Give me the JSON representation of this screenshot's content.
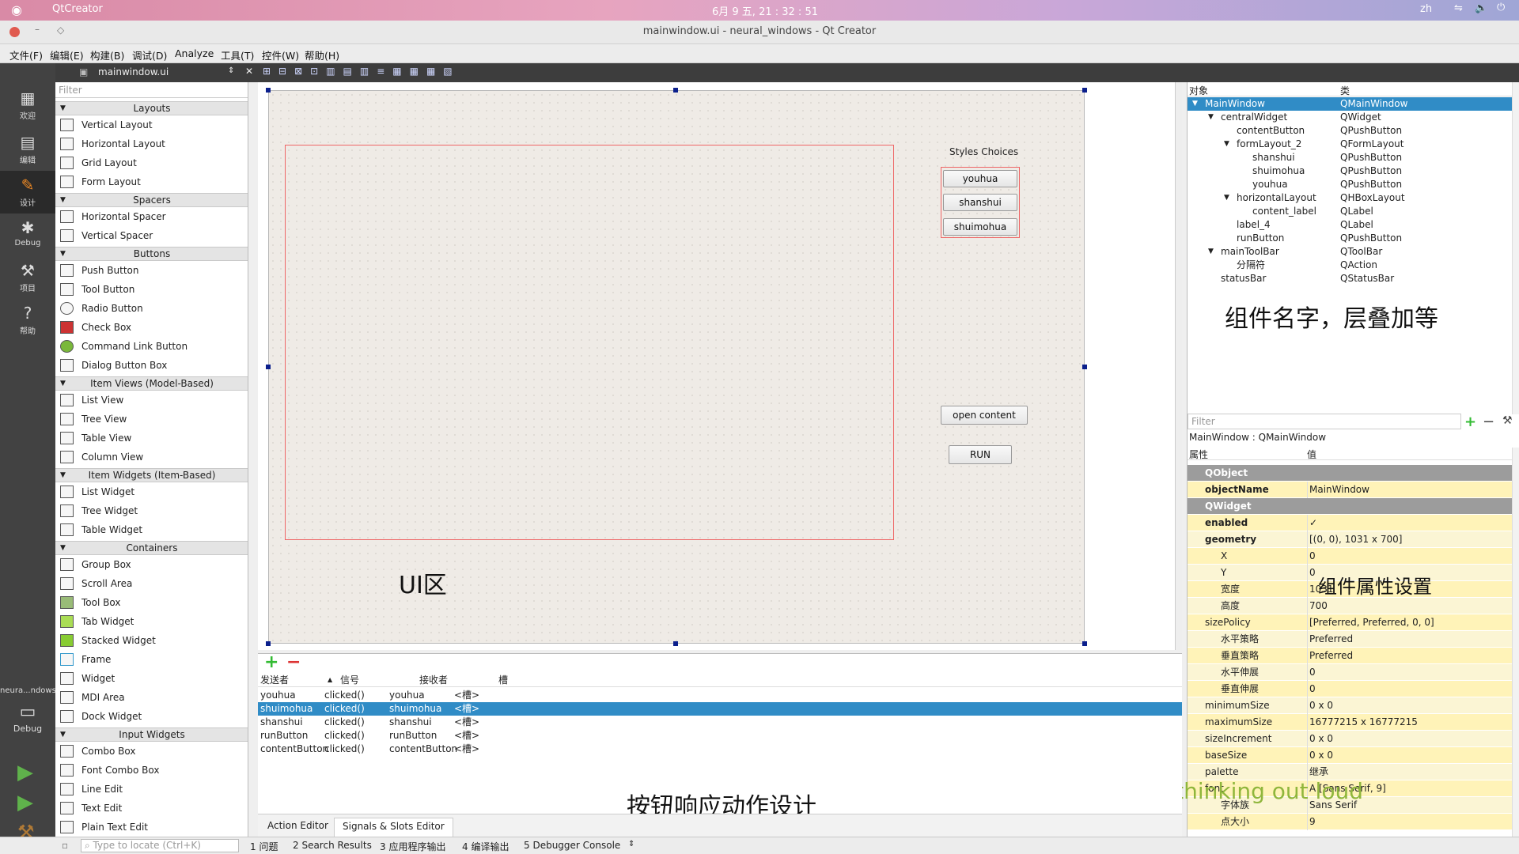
{
  "system_bar": {
    "app_name": "QtCreator",
    "datetime": "6月 9 五, 21 : 32 : 51",
    "lang": "zh"
  },
  "window": {
    "title": "mainwindow.ui - neural_windows - Qt Creator"
  },
  "menu": [
    "文件(F)",
    "编辑(E)",
    "构建(B)",
    "调试(D)",
    "Analyze",
    "工具(T)",
    "控件(W)",
    "帮助(H)"
  ],
  "modes": [
    {
      "label": "欢迎",
      "icon": "grid-icon"
    },
    {
      "label": "编辑",
      "icon": "edit-icon"
    },
    {
      "label": "设计",
      "icon": "design-icon"
    },
    {
      "label": "Debug",
      "icon": "bug-icon"
    },
    {
      "label": "项目",
      "icon": "wrench-icon"
    },
    {
      "label": "帮助",
      "icon": "help-icon"
    }
  ],
  "kit": {
    "project": "neura...ndows",
    "build": "Debug"
  },
  "file_tab": {
    "name": "mainwindow.ui"
  },
  "widget_box": {
    "filter_placeholder": "Filter",
    "layouts": {
      "title": "Layouts",
      "items": [
        "Vertical Layout",
        "Horizontal Layout",
        "Grid Layout",
        "Form Layout"
      ]
    },
    "spacers": {
      "title": "Spacers",
      "items": [
        "Horizontal Spacer",
        "Vertical Spacer"
      ]
    },
    "buttons": {
      "title": "Buttons",
      "items": [
        "Push Button",
        "Tool Button",
        "Radio Button",
        "Check Box",
        "Command Link Button",
        "Dialog Button Box"
      ]
    },
    "item_views": {
      "title": "Item Views (Model-Based)",
      "items": [
        "List View",
        "Tree View",
        "Table View",
        "Column View"
      ]
    },
    "item_widgets": {
      "title": "Item Widgets (Item-Based)",
      "items": [
        "List Widget",
        "Tree Widget",
        "Table Widget"
      ]
    },
    "containers": {
      "title": "Containers",
      "items": [
        "Group Box",
        "Scroll Area",
        "Tool Box",
        "Tab Widget",
        "Stacked Widget",
        "Frame",
        "Widget",
        "MDI Area",
        "Dock Widget"
      ]
    },
    "input_widgets": {
      "title": "Input Widgets",
      "items": [
        "Combo Box",
        "Font Combo Box",
        "Line Edit",
        "Text Edit",
        "Plain Text Edit"
      ]
    }
  },
  "form": {
    "styles_label": "Styles Choices",
    "style_buttons": [
      "youhua",
      "shanshui",
      "shuimohua"
    ],
    "open_content": "open content",
    "run": "RUN"
  },
  "annotations": {
    "ui_area": "UI区",
    "components": "组件名字，层叠加等",
    "properties": "组件属性设置",
    "signals": "按钮响应动作设计",
    "thinking": "I'm thinking out loud"
  },
  "object_inspector": {
    "headers": [
      "对象",
      "类"
    ],
    "rows": [
      {
        "name": "MainWindow",
        "cls": "QMainWindow",
        "indent": 0,
        "expand": "▼",
        "selected": true
      },
      {
        "name": "centralWidget",
        "cls": "QWidget",
        "indent": 1,
        "expand": "▼"
      },
      {
        "name": "contentButton",
        "cls": "QPushButton",
        "indent": 2,
        "expand": ""
      },
      {
        "name": "formLayout_2",
        "cls": "QFormLayout",
        "indent": 2,
        "expand": "▼"
      },
      {
        "name": "shanshui",
        "cls": "QPushButton",
        "indent": 3,
        "expand": ""
      },
      {
        "name": "shuimohua",
        "cls": "QPushButton",
        "indent": 3,
        "expand": ""
      },
      {
        "name": "youhua",
        "cls": "QPushButton",
        "indent": 3,
        "expand": ""
      },
      {
        "name": "horizontalLayout",
        "cls": "QHBoxLayout",
        "indent": 2,
        "expand": "▼"
      },
      {
        "name": "content_label",
        "cls": "QLabel",
        "indent": 3,
        "expand": ""
      },
      {
        "name": "label_4",
        "cls": "QLabel",
        "indent": 2,
        "expand": ""
      },
      {
        "name": "runButton",
        "cls": "QPushButton",
        "indent": 2,
        "expand": ""
      },
      {
        "name": "mainToolBar",
        "cls": "QToolBar",
        "indent": 1,
        "expand": "▼"
      },
      {
        "name": "分隔符",
        "cls": "QAction",
        "indent": 2,
        "expand": ""
      },
      {
        "name": "statusBar",
        "cls": "QStatusBar",
        "indent": 1,
        "expand": ""
      }
    ]
  },
  "property_editor": {
    "filter_placeholder": "Filter",
    "context": "MainWindow : QMainWindow",
    "headers": [
      "属性",
      "值"
    ],
    "rows": [
      {
        "name": "QObject",
        "value": "",
        "type": "hdr"
      },
      {
        "name": "objectName",
        "value": "MainWindow",
        "type": "bold"
      },
      {
        "name": "QWidget",
        "value": "",
        "type": "hdr"
      },
      {
        "name": "enabled",
        "value": "✓",
        "type": "bold"
      },
      {
        "name": "geometry",
        "value": "[(0, 0), 1031 x 700]",
        "type": "bold"
      },
      {
        "name": "X",
        "value": "0",
        "type": "sub"
      },
      {
        "name": "Y",
        "value": "0",
        "type": "sub"
      },
      {
        "name": "宽度",
        "value": "1031",
        "type": "sub"
      },
      {
        "name": "高度",
        "value": "700",
        "type": "sub"
      },
      {
        "name": "sizePolicy",
        "value": "[Preferred, Preferred, 0, 0]",
        "type": "norm"
      },
      {
        "name": "水平策略",
        "value": "Preferred",
        "type": "sub"
      },
      {
        "name": "垂直策略",
        "value": "Preferred",
        "type": "sub"
      },
      {
        "name": "水平伸展",
        "value": "0",
        "type": "sub"
      },
      {
        "name": "垂直伸展",
        "value": "0",
        "type": "sub"
      },
      {
        "name": "minimumSize",
        "value": "0 x 0",
        "type": "norm"
      },
      {
        "name": "maximumSize",
        "value": "16777215 x 16777215",
        "type": "norm"
      },
      {
        "name": "sizeIncrement",
        "value": "0 x 0",
        "type": "norm"
      },
      {
        "name": "baseSize",
        "value": "0 x 0",
        "type": "norm"
      },
      {
        "name": "palette",
        "value": "继承",
        "type": "norm"
      },
      {
        "name": "font",
        "value": "A [Sans Serif, 9]",
        "type": "norm"
      },
      {
        "name": "字体族",
        "value": "Sans Serif",
        "type": "sub"
      },
      {
        "name": "点大小",
        "value": "9",
        "type": "sub"
      }
    ]
  },
  "signal_editor": {
    "headers": [
      "发送者",
      "信号",
      "接收者",
      "槽"
    ],
    "rows": [
      [
        "youhua",
        "clicked()",
        "youhua",
        "<槽>"
      ],
      [
        "shuimohua",
        "clicked()",
        "shuimohua",
        "<槽>"
      ],
      [
        "shanshui",
        "clicked()",
        "shanshui",
        "<槽>"
      ],
      [
        "runButton",
        "clicked()",
        "runButton",
        "<槽>"
      ],
      [
        "contentButton",
        "clicked()",
        "contentButton",
        "<槽>"
      ]
    ],
    "selected_index": 1,
    "tabs": [
      "Action Editor",
      "Signals & Slots Editor"
    ]
  },
  "status_bar": {
    "locate_placeholder": "Type to locate (Ctrl+K)",
    "panes": [
      "1 问题",
      "2 Search Results",
      "3 应用程序输出",
      "4 编译输出",
      "5 Debugger Console"
    ]
  },
  "colors": {
    "selection": "#308cc6",
    "mode_bar": "#424242",
    "prop_row": "#fbf5d4"
  }
}
